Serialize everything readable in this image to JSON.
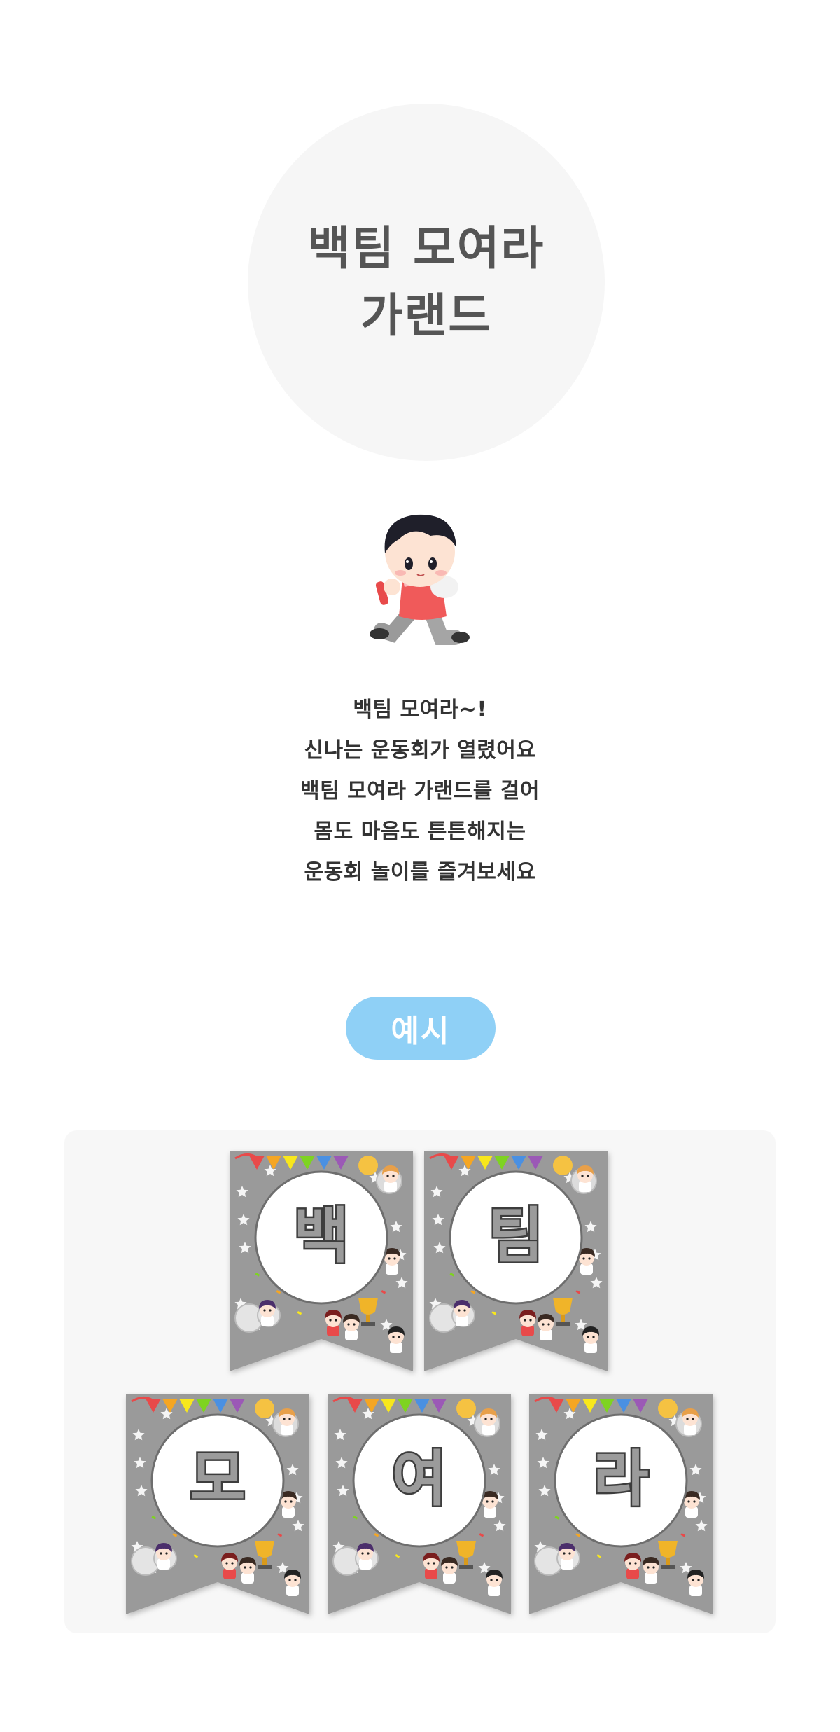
{
  "header": {
    "title_line1": "백팀 모여라",
    "title_line2": "가랜드"
  },
  "intro": {
    "lines": [
      "백팀 모여라~!",
      "신나는 운동회가 열렸어요",
      "백팀 모여라 가랜드를 걸어",
      "몸도 마음도 튼튼해지는",
      "운동회 놀이를 즐겨보세요"
    ]
  },
  "example": {
    "label": "예시"
  },
  "garland": {
    "flags": [
      {
        "letter": "백"
      },
      {
        "letter": "팀"
      },
      {
        "letter": "모"
      },
      {
        "letter": "여"
      },
      {
        "letter": "라"
      }
    ]
  },
  "colors": {
    "title_circle": "#f6f6f6",
    "example_pill": "#8fd0f6",
    "panel": "#f7f7f7",
    "flag_background": "#9a9a9a"
  }
}
